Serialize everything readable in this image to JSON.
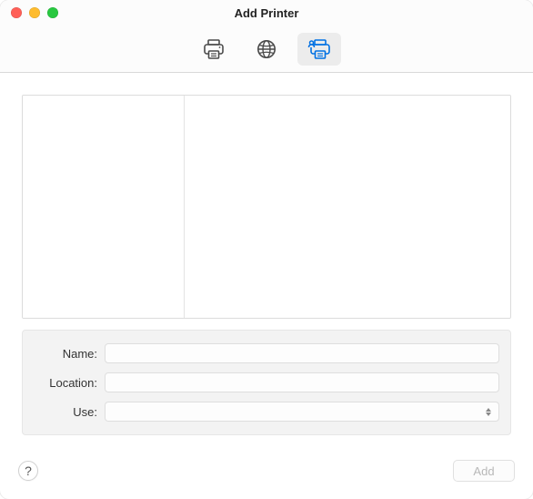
{
  "window": {
    "title": "Add Printer"
  },
  "toolbar": {
    "tabs": [
      {
        "name": "default",
        "selected": false
      },
      {
        "name": "ip",
        "selected": false
      },
      {
        "name": "windows",
        "selected": true
      }
    ]
  },
  "form": {
    "name_label": "Name:",
    "name_value": "",
    "location_label": "Location:",
    "location_value": "",
    "use_label": "Use:",
    "use_value": ""
  },
  "footer": {
    "help_label": "?",
    "add_label": "Add",
    "add_enabled": false
  }
}
